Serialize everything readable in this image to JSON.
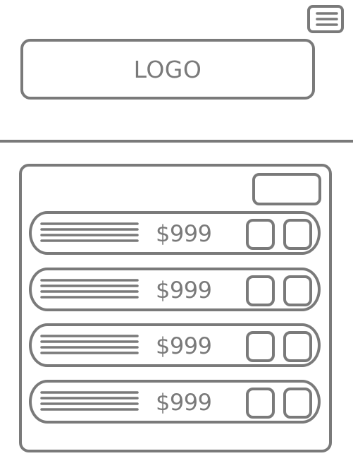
{
  "header": {
    "logo_text": "LOGO",
    "menu_icon": "hamburger-menu-icon"
  },
  "list": {
    "rows": [
      {
        "price": "$999"
      },
      {
        "price": "$999"
      },
      {
        "price": "$999"
      },
      {
        "price": "$999"
      }
    ]
  },
  "colors": {
    "stroke": "#7a7a7a",
    "background": "#ffffff"
  }
}
